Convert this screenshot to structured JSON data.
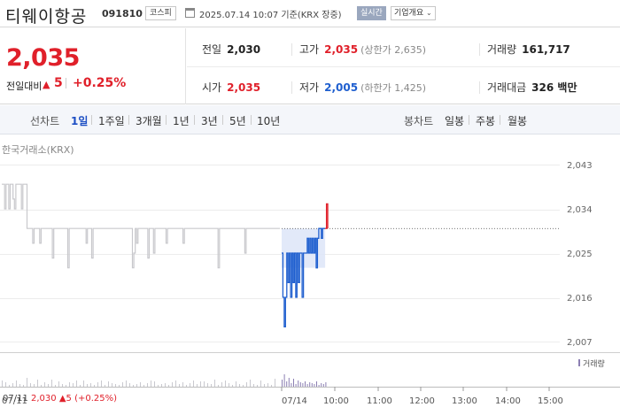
{
  "header": {
    "name": "티웨이항공",
    "code": "091810",
    "market": "코스피",
    "asof": "2025.07.14 10:07 기준(KRX 장중)",
    "realtime": "실시간",
    "company_btn": "기업개요"
  },
  "quote": {
    "price": "2,035",
    "change_label": "전일대비",
    "change_arrow": "▲",
    "change": "5",
    "change_pct": "+0.25%",
    "prev_close_label": "전일",
    "prev_close": "2,030",
    "high_label": "고가",
    "high": "2,035",
    "upper_limit": "(상한가 2,635)",
    "volume_label": "거래량",
    "volume": "161,717",
    "open_label": "시가",
    "open": "2,035",
    "low_label": "저가",
    "low": "2,005",
    "lower_limit": "(하한가 1,425)",
    "amount_label": "거래대금",
    "amount": "326 백만"
  },
  "periodbar": {
    "line_label": "선차트",
    "periods": [
      "1일",
      "1주일",
      "3개월",
      "1년",
      "3년",
      "5년",
      "10년"
    ],
    "active": "1일",
    "candle_label": "봉차트",
    "candles": [
      "일봉",
      "주봉",
      "월봉"
    ]
  },
  "chart": {
    "source": "한국거래소(KRX)",
    "y_ticks": [
      "2,043",
      "2,034",
      "2,025",
      "2,016",
      "2,007"
    ],
    "x_ticks": [
      "07/11",
      "07/14",
      "10:00",
      "11:00",
      "12:00",
      "13:00",
      "14:00",
      "15:00"
    ],
    "volume_legend": "거래량",
    "footer_date": "07/11",
    "footer_price": "2,030",
    "footer_arrow": "▲",
    "footer_change": "5",
    "footer_pct": "(+0.25%)",
    "colors": {
      "up": "#e0202a",
      "down": "#1f5fcf",
      "prev_line": "#c8c8cc",
      "fill": "#dfe7f8"
    }
  },
  "chart_data": {
    "type": "line",
    "title": "",
    "xlabel": "",
    "ylabel": "",
    "ylim": [
      2007,
      2043
    ],
    "reference_price": 2030,
    "series": [
      {
        "segment": "07/11 (previous session)",
        "y": [
          2039,
          2039,
          2034,
          2039,
          2039,
          2034,
          2039,
          2039,
          2036,
          2034,
          2039,
          2039,
          2039,
          2039,
          2034,
          2039,
          2039,
          2039,
          2030,
          2030,
          2030,
          2030,
          2027,
          2030,
          2030,
          2030,
          2030,
          2027,
          2030,
          2030,
          2030,
          2030,
          2030,
          2030,
          2030,
          2030,
          2024,
          2030,
          2030,
          2030,
          2030,
          2030,
          2030,
          2030,
          2030,
          2030,
          2030,
          2022,
          2030,
          2030,
          2030,
          2030,
          2030,
          2030,
          2030,
          2030,
          2030,
          2030,
          2030,
          2030,
          2027,
          2030,
          2030,
          2030,
          2024,
          2030,
          2030,
          2030,
          2030,
          2030,
          2030,
          2030,
          2030,
          2030,
          2030,
          2030,
          2030,
          2030,
          2030,
          2030,
          2030,
          2030,
          2030,
          2030,
          2030,
          2030,
          2030,
          2030,
          2030,
          2030,
          2030,
          2030,
          2030,
          2022,
          2025,
          2030,
          2027,
          2030,
          2030,
          2030,
          2030,
          2030,
          2030,
          2030,
          2024,
          2030,
          2030,
          2030,
          2025,
          2030,
          2030,
          2030,
          2030,
          2030,
          2030,
          2030,
          2030,
          2027,
          2030,
          2030,
          2030,
          2030,
          2030,
          2030,
          2030,
          2030,
          2030,
          2030,
          2030,
          2027,
          2030,
          2030,
          2030,
          2030,
          2030,
          2030,
          2030,
          2030,
          2030,
          2030,
          2030,
          2030,
          2030,
          2030,
          2030,
          2030,
          2030,
          2030,
          2030,
          2030,
          2030,
          2030,
          2030,
          2030,
          2022,
          2030,
          2030,
          2030,
          2030,
          2030,
          2030,
          2030,
          2030,
          2030,
          2030,
          2030,
          2030,
          2030,
          2030,
          2030,
          2030,
          2030,
          2030,
          2025,
          2030,
          2030,
          2030,
          2030,
          2030,
          2030,
          2030,
          2030,
          2030,
          2030,
          2030,
          2030,
          2030,
          2030,
          2030,
          2030,
          2030,
          2030,
          2030,
          2030,
          2030,
          2030,
          2030,
          2030,
          2030
        ]
      },
      {
        "segment": "07/14 (today)",
        "y": [
          2025,
          2016,
          2010,
          2016,
          2025,
          2019,
          2025,
          2016,
          2025,
          2019,
          2025,
          2016,
          2025,
          2019,
          2025,
          2025,
          2016,
          2025,
          2025,
          2025,
          2028,
          2025,
          2028,
          2025,
          2028,
          2025,
          2028,
          2022,
          2028,
          2030,
          2030,
          2028,
          2030,
          2030,
          2030,
          2035,
          2030
        ]
      }
    ]
  }
}
